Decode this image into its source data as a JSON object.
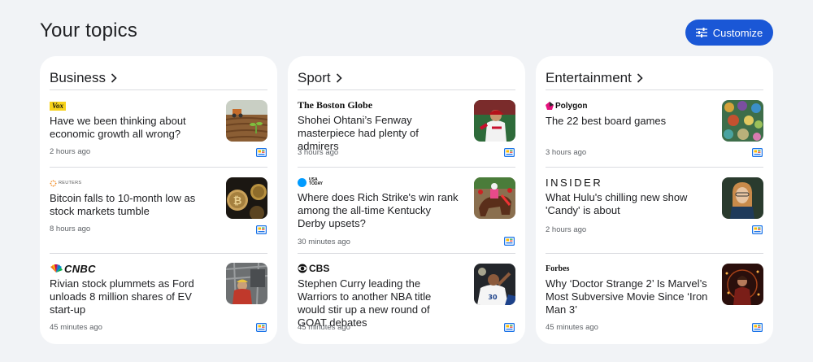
{
  "page": {
    "title": "Your topics"
  },
  "customize": {
    "label": "Customize",
    "icon": "tune-icon",
    "color": "#1a57d6"
  },
  "topics": [
    {
      "title": "Business",
      "stories": [
        {
          "source": "Vox",
          "headline": "Have we been thinking about economic growth all wrong?",
          "time": "2 hours ago"
        },
        {
          "source": "REUTERS",
          "headline": "Bitcoin falls to 10-month low as stock markets tumble",
          "time": "8 hours ago"
        },
        {
          "source": "CNBC",
          "headline": "Rivian stock plummets as Ford unloads 8 million shares of EV start-up",
          "time": "45 minutes ago"
        }
      ]
    },
    {
      "title": "Sport",
      "stories": [
        {
          "source": "The Boston Globe",
          "headline": "Shohei Ohtani’s Fenway masterpiece had plenty of admirers",
          "time": "3 hours ago"
        },
        {
          "source": "USA TODAY",
          "headline": "Where does Rich Strike's win rank among the all-time Kentucky Derby upsets?",
          "time": "30 minutes ago"
        },
        {
          "source": "CBS",
          "headline": "Stephen Curry leading the Warriors to another NBA title would stir up a new round of GOAT debates",
          "time": "45 minutes ago"
        }
      ]
    },
    {
      "title": "Entertainment",
      "stories": [
        {
          "source": "Polygon",
          "headline": "The 22 best board games",
          "time": "3 hours ago"
        },
        {
          "source": "INSIDER",
          "headline": "What Hulu's chilling new show 'Candy' is about",
          "time": "2 hours ago"
        },
        {
          "source": "Forbes",
          "headline": "Why ‘Doctor Strange 2’ Is Marvel’s Most Subversive Movie Since ‘Iron Man 3’",
          "time": "45 minutes ago"
        }
      ]
    }
  ]
}
